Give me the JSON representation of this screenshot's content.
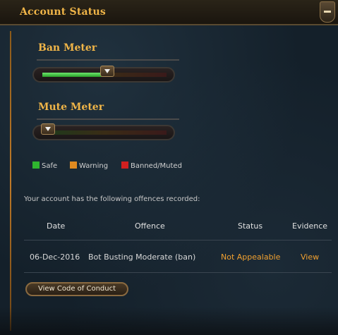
{
  "header": {
    "title": "Account Status"
  },
  "ban_meter": {
    "title": "Ban Meter",
    "level": 0.52
  },
  "mute_meter": {
    "title": "Mute Meter",
    "level": 0.0
  },
  "legend": [
    {
      "label": "Safe",
      "color": "#2fb52f"
    },
    {
      "label": "Warning",
      "color": "#e08a20"
    },
    {
      "label": "Banned/Muted",
      "color": "#d02020"
    }
  ],
  "offences": {
    "intro": "Your account has the following offences recorded:",
    "columns": {
      "date": "Date",
      "offence": "Offence",
      "status": "Status",
      "evidence": "Evidence"
    },
    "rows": [
      {
        "date": "06-Dec-2016",
        "offence": "Bot Busting Moderate (ban)",
        "status": "Not Appealable",
        "evidence": "View"
      }
    ]
  },
  "buttons": {
    "code_of_conduct": "View Code of Conduct"
  },
  "colors": {
    "title_gold": "#f0b548",
    "link_orange": "#f0a030"
  }
}
